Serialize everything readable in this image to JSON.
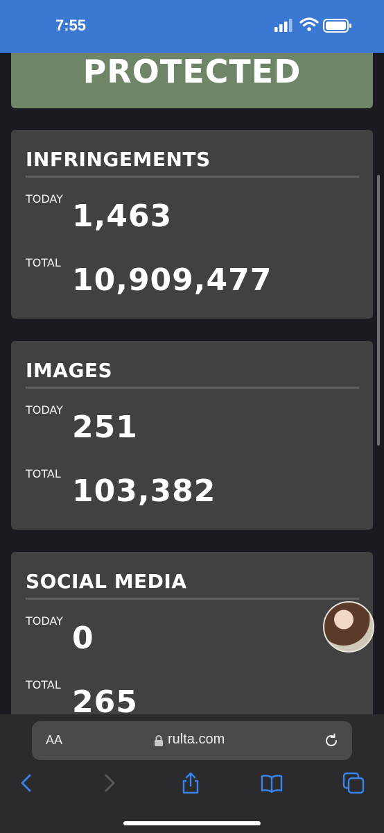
{
  "status_bar": {
    "time": "7:55",
    "background": "#3a78d2"
  },
  "banner": {
    "text": "PROTECTED",
    "color": "#6e8568"
  },
  "cards": [
    {
      "title": "INFRINGEMENTS",
      "today_label": "TODAY",
      "today_value": "1,463",
      "total_label": "TOTAL",
      "total_value": "10,909,477"
    },
    {
      "title": "IMAGES",
      "today_label": "TODAY",
      "today_value": "251",
      "total_label": "TOTAL",
      "total_value": "103,382"
    },
    {
      "title": "SOCIAL MEDIA",
      "today_label": "TODAY",
      "today_value": "0",
      "total_label": "TOTAL",
      "total_value": "265"
    }
  ],
  "browser": {
    "text_size_label": "AA",
    "url": "rulta.com",
    "icons": [
      "back-icon",
      "forward-icon",
      "share-icon",
      "bookmarks-icon",
      "tabs-icon"
    ],
    "accent": "#3a84f0"
  }
}
